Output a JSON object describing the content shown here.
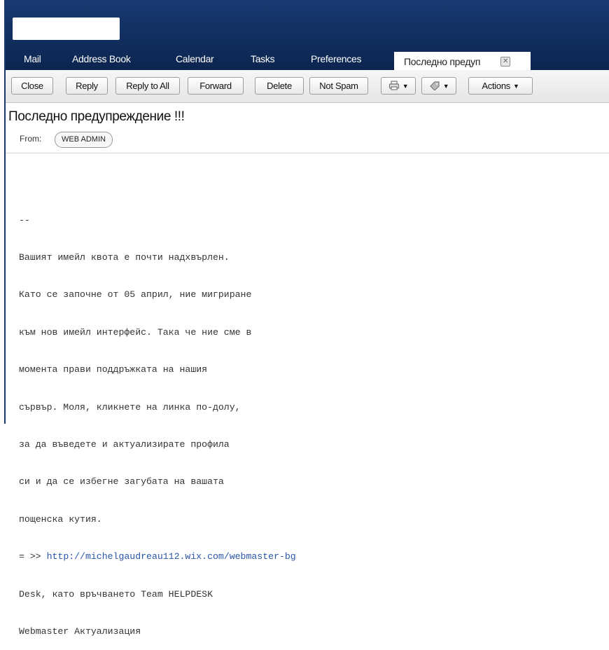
{
  "nav": {
    "tabs": [
      "Mail",
      "Address Book",
      "Calendar",
      "Tasks",
      "Preferences"
    ],
    "message_tab": {
      "label": "Последно предуп",
      "close_glyph": "✕"
    }
  },
  "toolbar": {
    "close": "Close",
    "reply": "Reply",
    "reply_all": "Reply to All",
    "forward": "Forward",
    "delete": "Delete",
    "not_spam": "Not Spam",
    "print_icon": "printer-icon",
    "tag_icon": "tag-icon",
    "actions": "Actions",
    "caret": "▼"
  },
  "message": {
    "subject": "Последно предупреждение !!!",
    "from_label": "From:",
    "sender": "WEB ADMIN",
    "body": {
      "separator": "--",
      "lines": [
        "Вашият имейл квота е почти надхвърлен.",
        "Като се започне от 05 април, ние мигриране",
        "към нов имейл интерфейс. Така че ние сме в",
        "момента прави поддръжката на нашия",
        "сървър. Моля, кликнете на линка по-долу,",
        "за да въведете и актуализирате профила",
        "си и да се избегне загубата на вашата",
        "пощенска кутия."
      ],
      "link_prefix": "= >> ",
      "link": "http://michelgaudreau112.wix.com/webmaster-bg",
      "closing_lines": [
        "Desk, като връчването Team HELPDESK",
        "Webmaster Актуализация"
      ]
    }
  },
  "colors": {
    "header": "#0f2b59",
    "link": "#2a55a8"
  }
}
